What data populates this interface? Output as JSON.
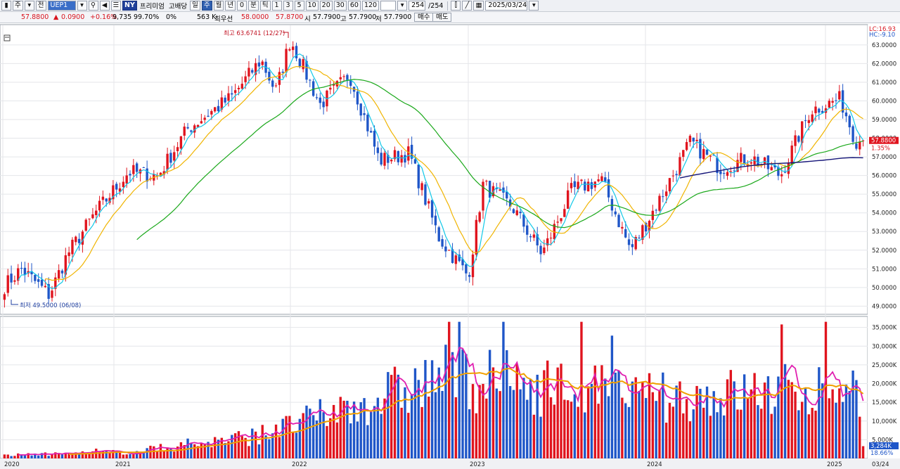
{
  "toolbar": {
    "type_label": "주",
    "prev_label": "전",
    "symbol": "UEP1",
    "ny_label": "NY",
    "premium_label": "프리미엄",
    "dividend_label": "고배당",
    "period_day": "일",
    "period_week": "주",
    "period_month": "월",
    "period_year": "년",
    "period_q": "0",
    "period_min": "분",
    "period_tick": "틱",
    "intervals": [
      "1",
      "3",
      "5",
      "10",
      "20",
      "30",
      "60",
      "120"
    ],
    "count": "254",
    "count_total": "/254",
    "date": "2025/03/24"
  },
  "infobar": {
    "price": "57.8800",
    "change_arrow": "▲",
    "change": "0.0900",
    "change_pct": "+0.16%",
    "value1": "9,735",
    "value2": "99.70%",
    "value3": "0%",
    "volume": "563 K",
    "best_label": "최우선",
    "best_sell": "58.0000",
    "best_buy": "57.8700",
    "open_label": "시",
    "open": "57.7900",
    "high_label": "고",
    "high": "57.7900",
    "low_label": "저",
    "low": "57.7900",
    "buy_label": "매수",
    "sell_label": "매도"
  },
  "price_axis": {
    "lc": "LC:16.93",
    "hc": "HC:-9.10",
    "ticks": [
      "63.0000",
      "62.0000",
      "61.0000",
      "60.0000",
      "59.0000",
      "58.0000",
      "57.0000",
      "56.0000",
      "55.0000",
      "54.0000",
      "53.0000",
      "52.0000",
      "51.0000",
      "50.0000",
      "49.0000"
    ],
    "current_price": "57.8800",
    "current_pct": "1.35%"
  },
  "volume_axis": {
    "ticks": [
      "35,000K",
      "30,000K",
      "25,000K",
      "20,000K",
      "15,000K",
      "10,000K",
      "5,000K"
    ],
    "current_volume": "3,284K",
    "current_pct": "18.66%"
  },
  "time_axis": {
    "labels": [
      "2020",
      "2021",
      "2022",
      "2023",
      "2024",
      "2025"
    ],
    "last_label": "03/24"
  },
  "annotations": {
    "high": "최고 63.6741 (12/27)",
    "low": "최저 49.5000 (06/08)"
  },
  "colors": {
    "up": "#e0141e",
    "down": "#1f56c8",
    "ma_fast": "#10c8e8",
    "ma_mid": "#f0b400",
    "ma_slow": "#1aa81a",
    "ma_long": "#141478",
    "vol_ma_fast": "#e020b0",
    "vol_ma_slow": "#f0a000"
  },
  "chart_data": {
    "type": "candlestick",
    "period": "weekly",
    "y_range": [
      49,
      63.6741
    ],
    "high": 63.6741,
    "low": 49.5,
    "last_close": 57.88,
    "anchor_closes": [
      [
        "2020-01",
        50.0
      ],
      [
        "2020-03",
        51.0
      ],
      [
        "2020-06",
        49.6
      ],
      [
        "2020-08",
        51.8
      ],
      [
        "2020-11",
        54.0
      ],
      [
        "2021-02",
        56.2
      ],
      [
        "2021-04",
        56.0
      ],
      [
        "2021-06",
        58.5
      ],
      [
        "2021-09",
        60.2
      ],
      [
        "2021-11",
        62.2
      ],
      [
        "2021-12",
        60.5
      ],
      [
        "2022-01",
        63.3
      ],
      [
        "2022-03",
        59.8
      ],
      [
        "2022-05",
        61.4
      ],
      [
        "2022-07",
        56.8
      ],
      [
        "2022-09",
        57.2
      ],
      [
        "2022-11",
        52.7
      ],
      [
        "2023-01",
        50.6
      ],
      [
        "2023-02",
        55.5
      ],
      [
        "2023-04",
        54.3
      ],
      [
        "2023-06",
        51.8
      ],
      [
        "2023-08",
        55.2
      ],
      [
        "2023-10",
        55.8
      ],
      [
        "2023-12",
        52.0
      ],
      [
        "2024-02",
        54.8
      ],
      [
        "2024-04",
        57.8
      ],
      [
        "2024-06",
        56.4
      ],
      [
        "2024-08",
        57.0
      ],
      [
        "2024-10",
        56.0
      ],
      [
        "2024-12",
        59.5
      ],
      [
        "2025-02",
        60.1
      ],
      [
        "2025-03",
        57.88
      ]
    ],
    "volume_range_k": [
      0,
      37000
    ],
    "last_volume_k": 3284
  }
}
